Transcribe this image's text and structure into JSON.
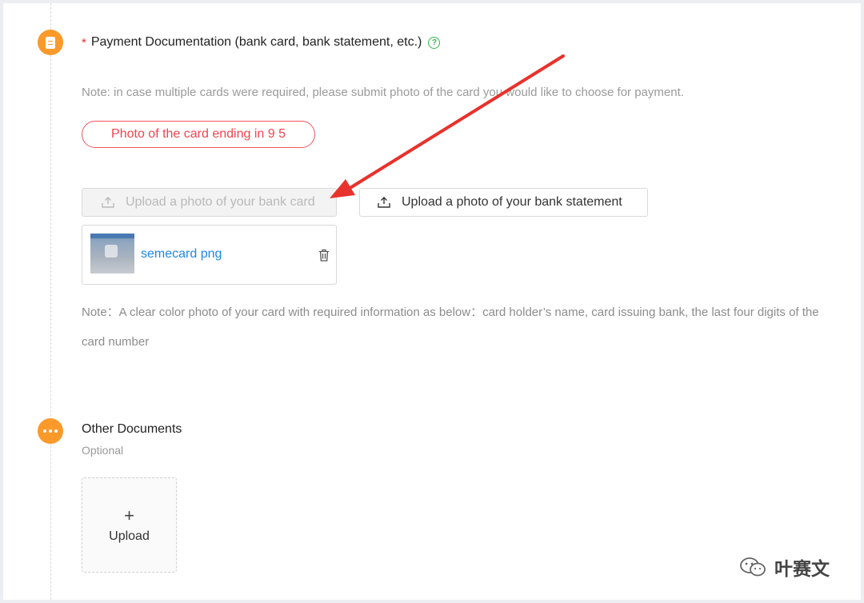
{
  "section1": {
    "required_mark": "*",
    "title": "Payment Documentation (bank card, bank statement, etc.)",
    "help_icon": "question-circle-icon",
    "note": "Note: in case multiple cards were required, please submit photo of the card you would like to choose for payment.",
    "card_tag": "Photo of the card ending in 9  5",
    "upload_card_label": "Upload a photo of your bank card",
    "upload_statement_label": "Upload a photo of your bank statement",
    "file": {
      "name": "semecard      png"
    },
    "note_2": "Note：A clear color photo of your card with required information as below：card holder’s name, card issuing bank, the last four digits of the card number"
  },
  "section2": {
    "title": "Other Documents",
    "subtitle": "Optional",
    "upload_plus": "+",
    "upload_label": "Upload"
  },
  "watermark": {
    "text": "叶赛文"
  },
  "colors": {
    "accent_orange": "#fa9a2b",
    "required_red": "#f5222d",
    "tag_red": "#f0454d",
    "link_blue": "#1e88e5",
    "arrow_red": "#e8322c"
  }
}
